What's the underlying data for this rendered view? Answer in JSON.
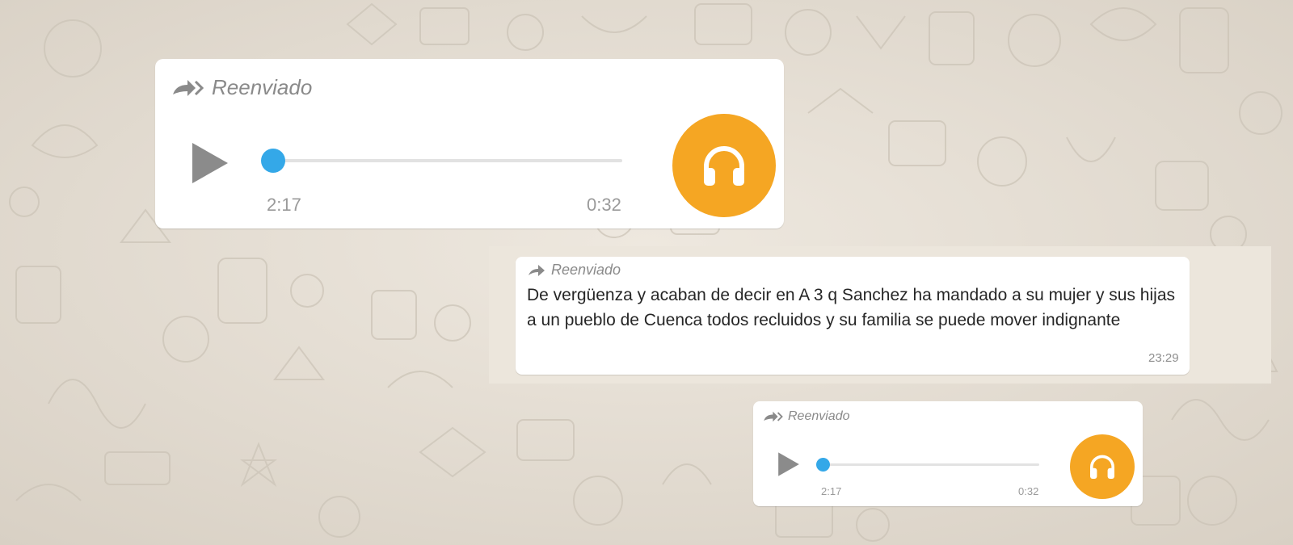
{
  "colors": {
    "accent": "#34a8e8",
    "avatar": "#f5a623",
    "bubble": "#ffffff",
    "background": "#e6dfd5"
  },
  "voice_message_1": {
    "forwarded_label": "Reenviado",
    "elapsed": "2:17",
    "duration": "0:32",
    "progress": 0.0,
    "avatar_icon": "headphones-icon"
  },
  "text_message": {
    "forwarded_label": "Reenviado",
    "body": "De vergüenza y acaban de decir en A 3 q Sanchez ha mandado a su mujer y sus hijas a un pueblo de Cuenca todos recluidos y su familia se puede mover indignante",
    "time": "23:29"
  },
  "voice_message_2": {
    "forwarded_label": "Reenviado",
    "elapsed": "2:17",
    "duration": "0:32",
    "progress": 0.0,
    "avatar_icon": "headphones-icon"
  }
}
